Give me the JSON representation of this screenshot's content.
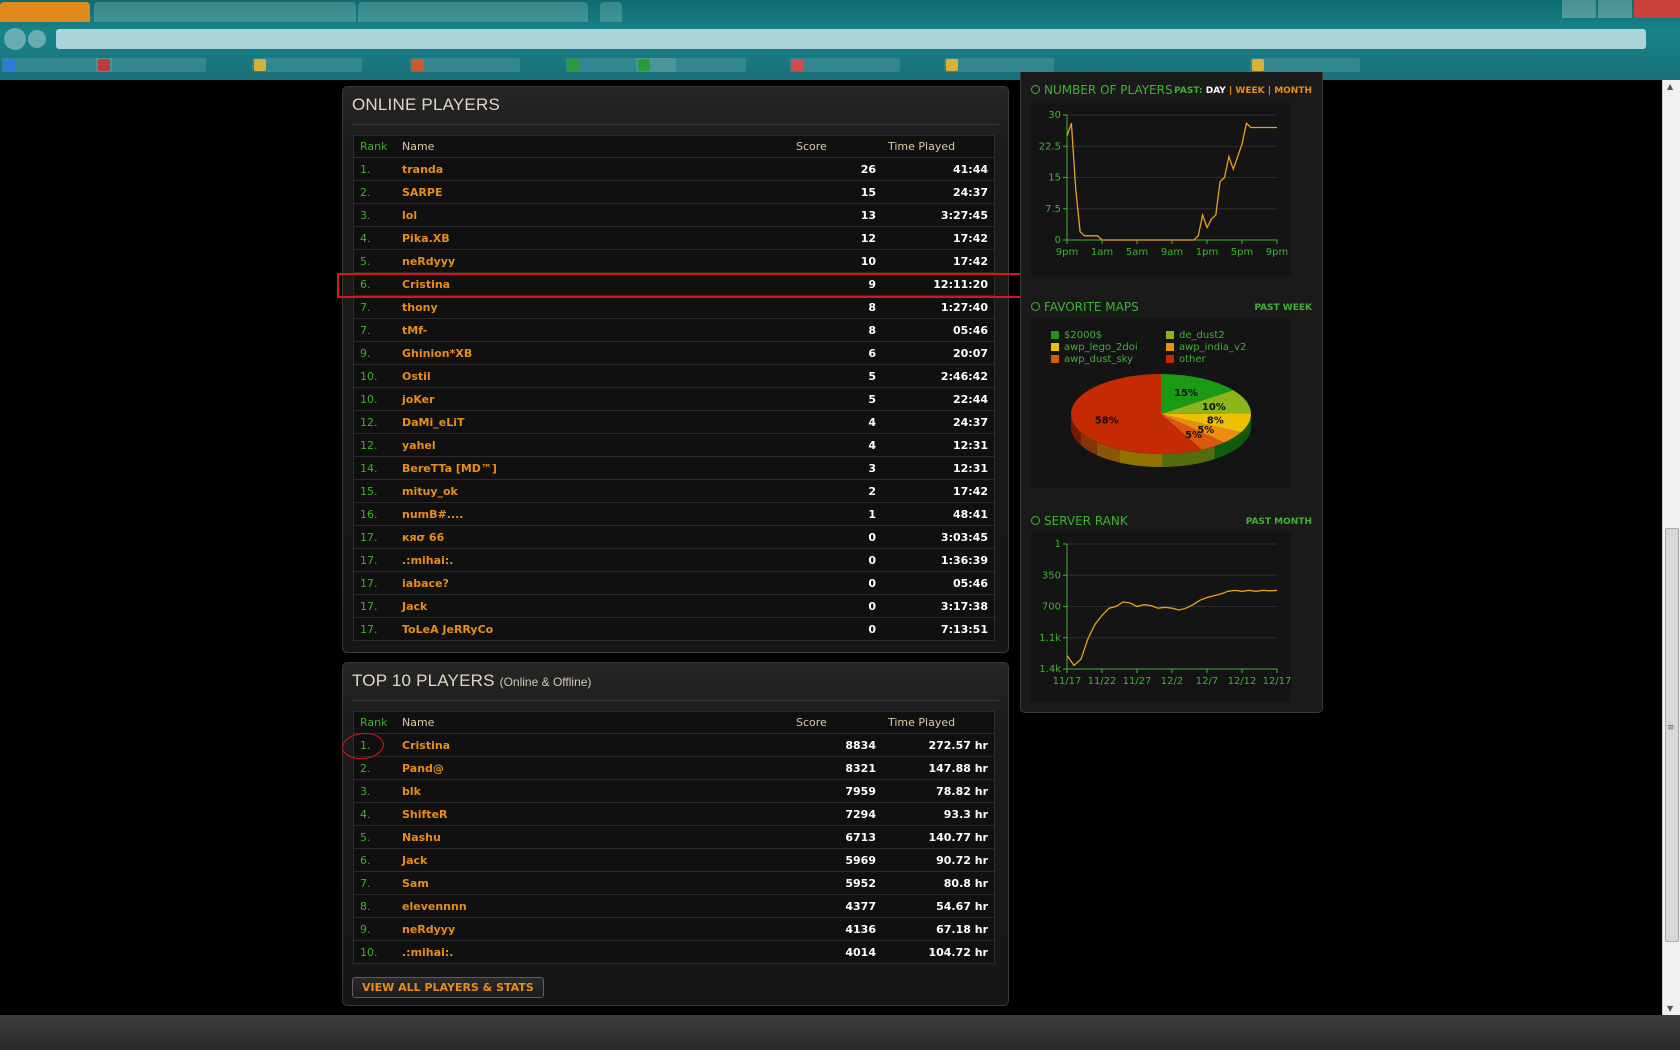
{
  "online": {
    "title": "ONLINE PLAYERS",
    "headers": {
      "rank": "Rank",
      "name": "Name",
      "score": "Score",
      "time": "Time Played"
    },
    "rows": [
      {
        "rank": "1.",
        "name": "tranda",
        "score": "26",
        "time": "41:44"
      },
      {
        "rank": "2.",
        "name": "SARPE",
        "score": "15",
        "time": "24:37"
      },
      {
        "rank": "3.",
        "name": "lol",
        "score": "13",
        "time": "3:27:45"
      },
      {
        "rank": "4.",
        "name": "Pika.XB",
        "score": "12",
        "time": "17:42"
      },
      {
        "rank": "5.",
        "name": "neRdyyy",
        "score": "10",
        "time": "17:42"
      },
      {
        "rank": "6.",
        "name": "Cristina",
        "score": "9",
        "time": "12:11:20"
      },
      {
        "rank": "7.",
        "name": "thony",
        "score": "8",
        "time": "1:27:40"
      },
      {
        "rank": "7.",
        "name": "tMf-",
        "score": "8",
        "time": "05:46"
      },
      {
        "rank": "9.",
        "name": "Ghinion*XB",
        "score": "6",
        "time": "20:07"
      },
      {
        "rank": "10.",
        "name": "Ostil",
        "score": "5",
        "time": "2:46:42"
      },
      {
        "rank": "10.",
        "name": "joKer",
        "score": "5",
        "time": "22:44"
      },
      {
        "rank": "12.",
        "name": "DaMi_eLiT",
        "score": "4",
        "time": "24:37"
      },
      {
        "rank": "12.",
        "name": "yahel",
        "score": "4",
        "time": "12:31"
      },
      {
        "rank": "14.",
        "name": "BereTTa [MD™]",
        "score": "3",
        "time": "12:31"
      },
      {
        "rank": "15.",
        "name": "mituy_ok",
        "score": "2",
        "time": "17:42"
      },
      {
        "rank": "16.",
        "name": "numB#....",
        "score": "1",
        "time": "48:41"
      },
      {
        "rank": "17.",
        "name": "кяσ 66",
        "score": "0",
        "time": "3:03:45"
      },
      {
        "rank": "17.",
        "name": ".:mihai:.",
        "score": "0",
        "time": "1:36:39"
      },
      {
        "rank": "17.",
        "name": "iabace?",
        "score": "0",
        "time": "05:46"
      },
      {
        "rank": "17.",
        "name": "Jack",
        "score": "0",
        "time": "3:17:38"
      },
      {
        "rank": "17.",
        "name": "ToLeA JeRRyCo",
        "score": "0",
        "time": "7:13:51"
      }
    ]
  },
  "top10": {
    "title": "TOP 10 PLAYERS",
    "subtitle": "(Online & Offline)",
    "headers": {
      "rank": "Rank",
      "name": "Name",
      "score": "Score",
      "time": "Time Played"
    },
    "rows": [
      {
        "rank": "1.",
        "name": "Cristina",
        "score": "8834",
        "time": "272.57 hr"
      },
      {
        "rank": "2.",
        "name": "Pand@",
        "score": "8321",
        "time": "147.88 hr"
      },
      {
        "rank": "3.",
        "name": "blk",
        "score": "7959",
        "time": "78.82 hr"
      },
      {
        "rank": "4.",
        "name": "ShifteR",
        "score": "7294",
        "time": "93.3 hr"
      },
      {
        "rank": "5.",
        "name": "Nashu",
        "score": "6713",
        "time": "140.77 hr"
      },
      {
        "rank": "6.",
        "name": "Jack",
        "score": "5969",
        "time": "90.72 hr"
      },
      {
        "rank": "7.",
        "name": "Sam",
        "score": "5952",
        "time": "80.8 hr"
      },
      {
        "rank": "8.",
        "name": "elevennnn",
        "score": "4377",
        "time": "54.67 hr"
      },
      {
        "rank": "9.",
        "name": "neRdyyy",
        "score": "4136",
        "time": "67.18 hr"
      },
      {
        "rank": "10.",
        "name": ".:mihai:.",
        "score": "4014",
        "time": "104.72 hr"
      }
    ],
    "button": "VIEW ALL PLAYERS & STATS"
  },
  "players_widget": {
    "title": "NUMBER OF PLAYERS",
    "period_label": "PAST:",
    "periods": [
      "DAY",
      "WEEK",
      "MONTH"
    ],
    "active_period": "DAY"
  },
  "maps_widget": {
    "title": "FAVORITE MAPS",
    "period": "PAST WEEK"
  },
  "rank_widget": {
    "title": "SERVER RANK",
    "period": "PAST MONTH"
  },
  "colors": {
    "accent_green": "#3fb233",
    "accent_orange": "#e98d1a",
    "highlight_red": "#d8151a"
  },
  "chart_data": [
    {
      "type": "line",
      "x_ticks": [
        "9pm",
        "1am",
        "5am",
        "9am",
        "1pm",
        "5pm",
        "9pm"
      ],
      "y_ticks": [
        "30",
        "22.5",
        "15",
        "7.5",
        "0"
      ],
      "ylim": [
        0,
        30
      ],
      "series": [
        {
          "x": [
            0,
            0.5,
            1,
            1.5,
            2,
            2.5,
            3,
            3.5,
            4,
            4.5,
            5,
            5.5,
            6,
            6.5,
            7,
            7.5,
            8,
            8.5,
            9,
            9.5,
            10,
            10.5,
            11,
            11.5,
            12,
            12.5,
            13,
            13.5,
            14,
            14.5,
            15,
            15.5,
            16,
            16.5,
            17,
            17.5,
            18,
            18.5,
            19,
            19.5,
            20,
            20.5,
            21,
            21.5,
            22,
            22.5,
            23,
            23.5,
            24
          ],
          "values": [
            25,
            28,
            12,
            2,
            1,
            1,
            1,
            1,
            0,
            0,
            0,
            0,
            0,
            0,
            0,
            0,
            0,
            0,
            0,
            0,
            0,
            0,
            0,
            0,
            0,
            0,
            0,
            0,
            0,
            0,
            1,
            6,
            3,
            5,
            6,
            14,
            15,
            20,
            17,
            20,
            23,
            28,
            27,
            27,
            27,
            27,
            27,
            27,
            27
          ]
        }
      ]
    },
    {
      "type": "pie",
      "categories": [
        "$2000$",
        "de_dust2",
        "awp_lego_2doi",
        "awp_india_v2",
        "awp_dust_sky",
        "other"
      ],
      "values": [
        15,
        10,
        8,
        5,
        5,
        58
      ],
      "labels": [
        "15%",
        "10%",
        "8%",
        "5%",
        "5%",
        "58%"
      ],
      "colors": [
        "#1a9a14",
        "#8cb41c",
        "#f0c000",
        "#ec8e12",
        "#d95a0e",
        "#c42a04"
      ]
    },
    {
      "type": "line",
      "x_ticks": [
        "11/17",
        "11/22",
        "11/27",
        "12/2",
        "12/7",
        "12/12",
        "12/17"
      ],
      "y_ticks": [
        "1",
        "350",
        "700",
        "1.1k",
        "1.4k"
      ],
      "ylim": [
        1400,
        1
      ],
      "series": [
        {
          "x": [
            0,
            1,
            2,
            3,
            4,
            5,
            6,
            7,
            8,
            9,
            10,
            11,
            12,
            13,
            14,
            15,
            16,
            17,
            18,
            19,
            20,
            21,
            22,
            23,
            24,
            25,
            26,
            27,
            28,
            29,
            30
          ],
          "values": [
            1250,
            1360,
            1290,
            1060,
            900,
            800,
            720,
            700,
            650,
            660,
            700,
            680,
            690,
            720,
            710,
            720,
            740,
            720,
            680,
            630,
            600,
            580,
            560,
            530,
            520,
            530,
            520,
            530,
            520,
            525,
            520
          ]
        }
      ]
    }
  ]
}
